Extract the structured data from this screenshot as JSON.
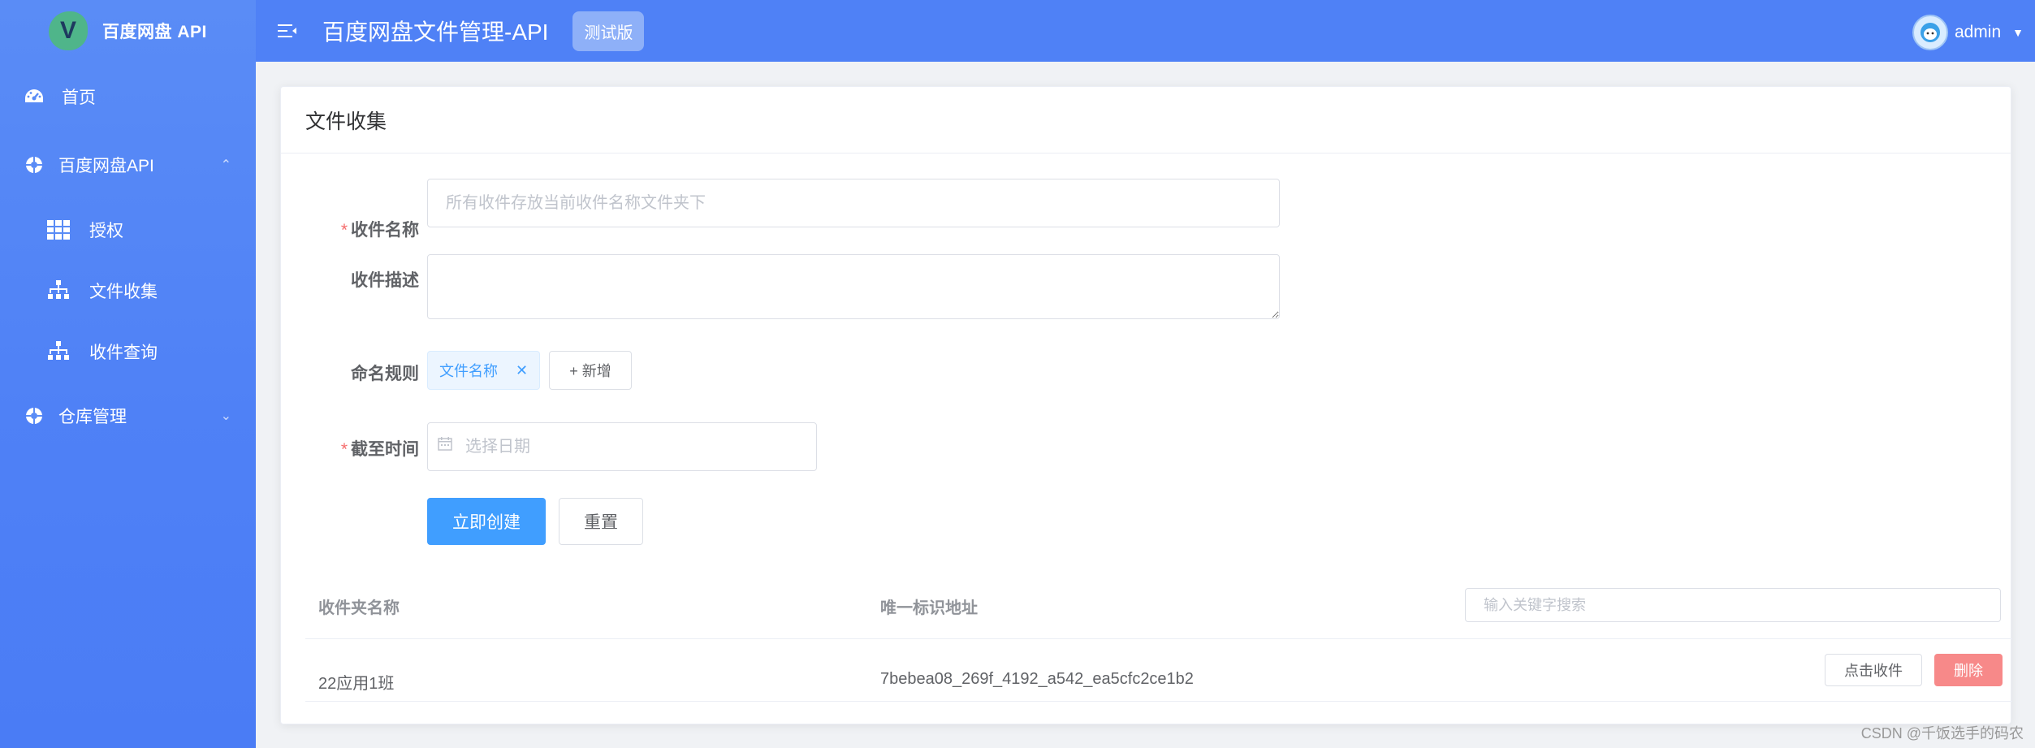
{
  "app": {
    "logo_letter": "V",
    "logo_text": "百度网盘 API"
  },
  "sidebar": {
    "items": [
      {
        "label": "首页",
        "icon": "dashboard-icon"
      },
      {
        "label": "百度网盘API",
        "icon": "cloud-icon"
      },
      {
        "label": "授权",
        "icon": "grid-icon"
      },
      {
        "label": "文件收集",
        "icon": "sitemap-icon"
      },
      {
        "label": "收件查询",
        "icon": "sitemap-icon"
      },
      {
        "label": "仓库管理",
        "icon": "cloud-icon"
      }
    ]
  },
  "header": {
    "title": "百度网盘文件管理-API",
    "badge": "测试版",
    "user": "admin"
  },
  "card": {
    "title": "文件收集"
  },
  "form": {
    "name_label": "收件名称",
    "name_placeholder": "所有收件存放当前收件名称文件夹下",
    "name_value": "",
    "desc_label": "收件描述",
    "desc_value": "",
    "rule_label": "命名规则",
    "rule_tag": "文件名称",
    "add_label": "+ 新增",
    "deadline_label": "截至时间",
    "deadline_placeholder": "选择日期",
    "create_label": "立即创建",
    "reset_label": "重置"
  },
  "table": {
    "columns": [
      "收件夹名称",
      "唯一标识地址"
    ],
    "search_placeholder": "输入关键字搜索",
    "rows": [
      {
        "name": "22应用1班",
        "id": "7bebea08_269f_4192_a542_ea5cfc2ce1b2",
        "collect_label": "点击收件",
        "delete_label": "删除"
      }
    ]
  },
  "watermark": "CSDN @千饭选手的码农",
  "colors": {
    "primary": "#409eff",
    "header": "#4f81f6",
    "danger": "#f78989"
  }
}
